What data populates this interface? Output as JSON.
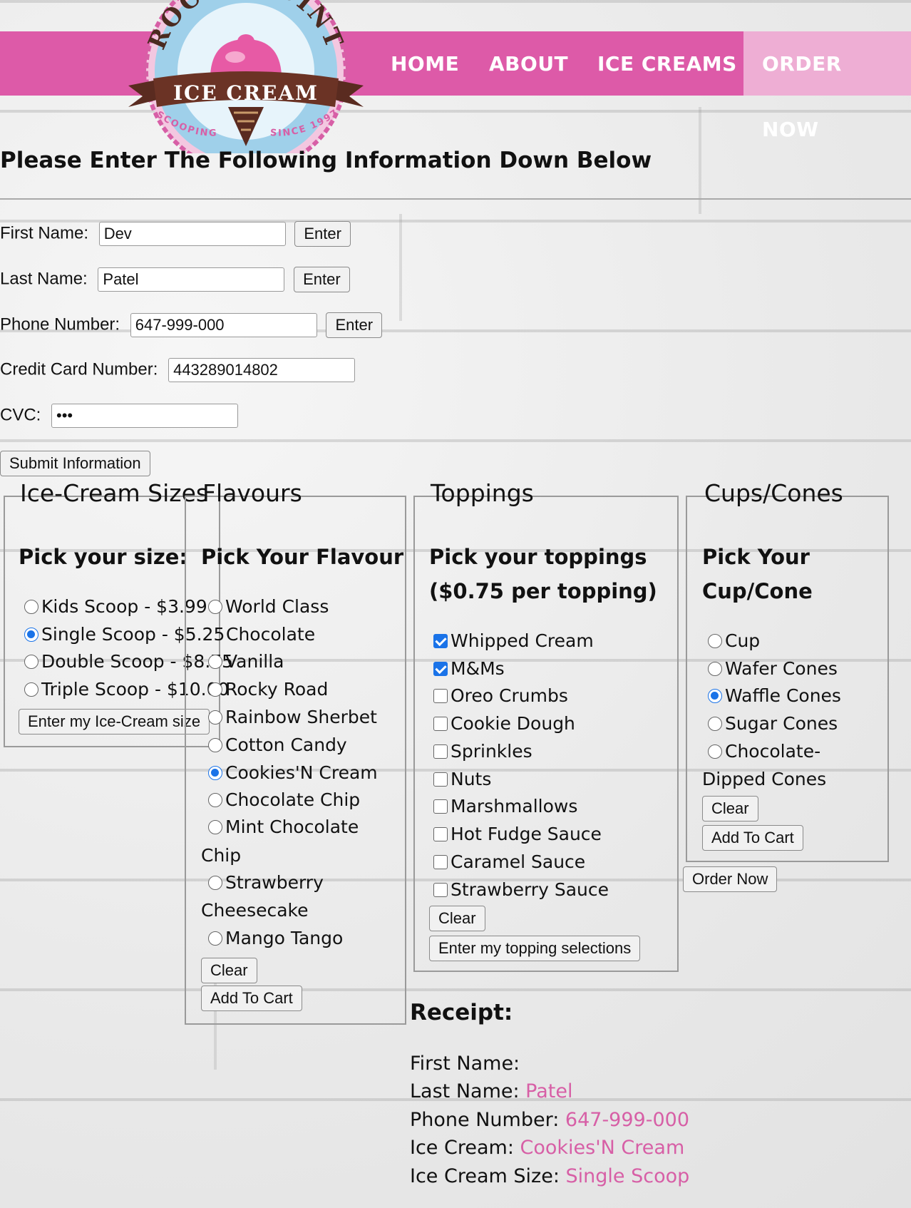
{
  "nav": {
    "items": [
      "HOME",
      "ABOUT",
      "ICE CREAMS",
      "ORDER NOW"
    ]
  },
  "logo": {
    "top_text": "ROCKY POINT",
    "banner_text": "ICE CREAM",
    "left_text": "SCOOPING",
    "right_text": "SINCE 1997"
  },
  "heading": "Please Enter The Following Information Down Below",
  "form": {
    "first_name": {
      "label": "First Name:",
      "value": "Dev",
      "button": "Enter"
    },
    "last_name": {
      "label": "Last Name:",
      "value": "Patel",
      "button": "Enter"
    },
    "phone": {
      "label": "Phone Number:",
      "value": "647-999-000",
      "button": "Enter"
    },
    "credit_card": {
      "label": "Credit Card Number:",
      "value": "443289014802"
    },
    "cvc": {
      "label": "CVC:",
      "value": "•••"
    },
    "submit": "Submit Information"
  },
  "sizes": {
    "legend": "Ice-Cream Sizes",
    "title": "Pick your size:",
    "options": [
      "Kids Scoop - $3.99",
      "Single Scoop - $5.25",
      "Double Scoop - $8.75",
      "Triple Scoop - $10.00"
    ],
    "selected": 1,
    "button": "Enter my Ice-Cream size"
  },
  "flavours": {
    "legend": "Flavours",
    "title": "Pick Your Flavour",
    "options": [
      "World Class",
      "Chocolate",
      "Vanilla",
      "Rocky Road",
      "Rainbow Sherbet",
      "Cotton Candy",
      "Cookies'N Cream",
      "Chocolate Chip",
      "Mint Chocolate",
      "Chip",
      "Strawberry",
      "Cheesecake",
      "Mango Tango"
    ],
    "selected": 6,
    "clear": "Clear",
    "add": "Add To Cart"
  },
  "toppings": {
    "legend": "Toppings",
    "title_line1": "Pick your toppings",
    "title_line2": "($0.75 per topping)",
    "options": [
      "Whipped Cream",
      "M&Ms",
      "Oreo Crumbs",
      "Cookie Dough",
      "Sprinkles",
      "Nuts",
      "Marshmallows",
      "Hot Fudge Sauce",
      "Caramel Sauce",
      "Strawberry Sauce"
    ],
    "checked": [
      0,
      1
    ],
    "clear": "Clear",
    "enter": "Enter my topping selections"
  },
  "cones": {
    "legend": "Cups/Cones",
    "title_line1": "Pick Your",
    "title_line2": "Cup/Cone",
    "options": [
      "Cup",
      "Wafer Cones",
      "Waffle Cones",
      "Sugar Cones",
      "Chocolate-"
    ],
    "wrap": "Dipped Cones",
    "selected": 2,
    "clear": "Clear",
    "add": "Add To Cart"
  },
  "order_now": "Order Now",
  "receipt": {
    "title": "Receipt:",
    "first_name_label": "First Name:",
    "first_name_value": "",
    "last_name_label": "Last Name:",
    "last_name_value": "Patel",
    "phone_label": "Phone Number:",
    "phone_value": "647-999-000",
    "ice_cream_label": "Ice Cream:",
    "ice_cream_value": "Cookies'N Cream",
    "size_label": "Ice Cream Size:",
    "size_value": "Single Scoop"
  },
  "colors": {
    "nav_pink": "#dd5aa8",
    "order_pink": "#eeaed4",
    "receipt_value": "#d75fa6",
    "radio_blue": "#1a73e8"
  }
}
